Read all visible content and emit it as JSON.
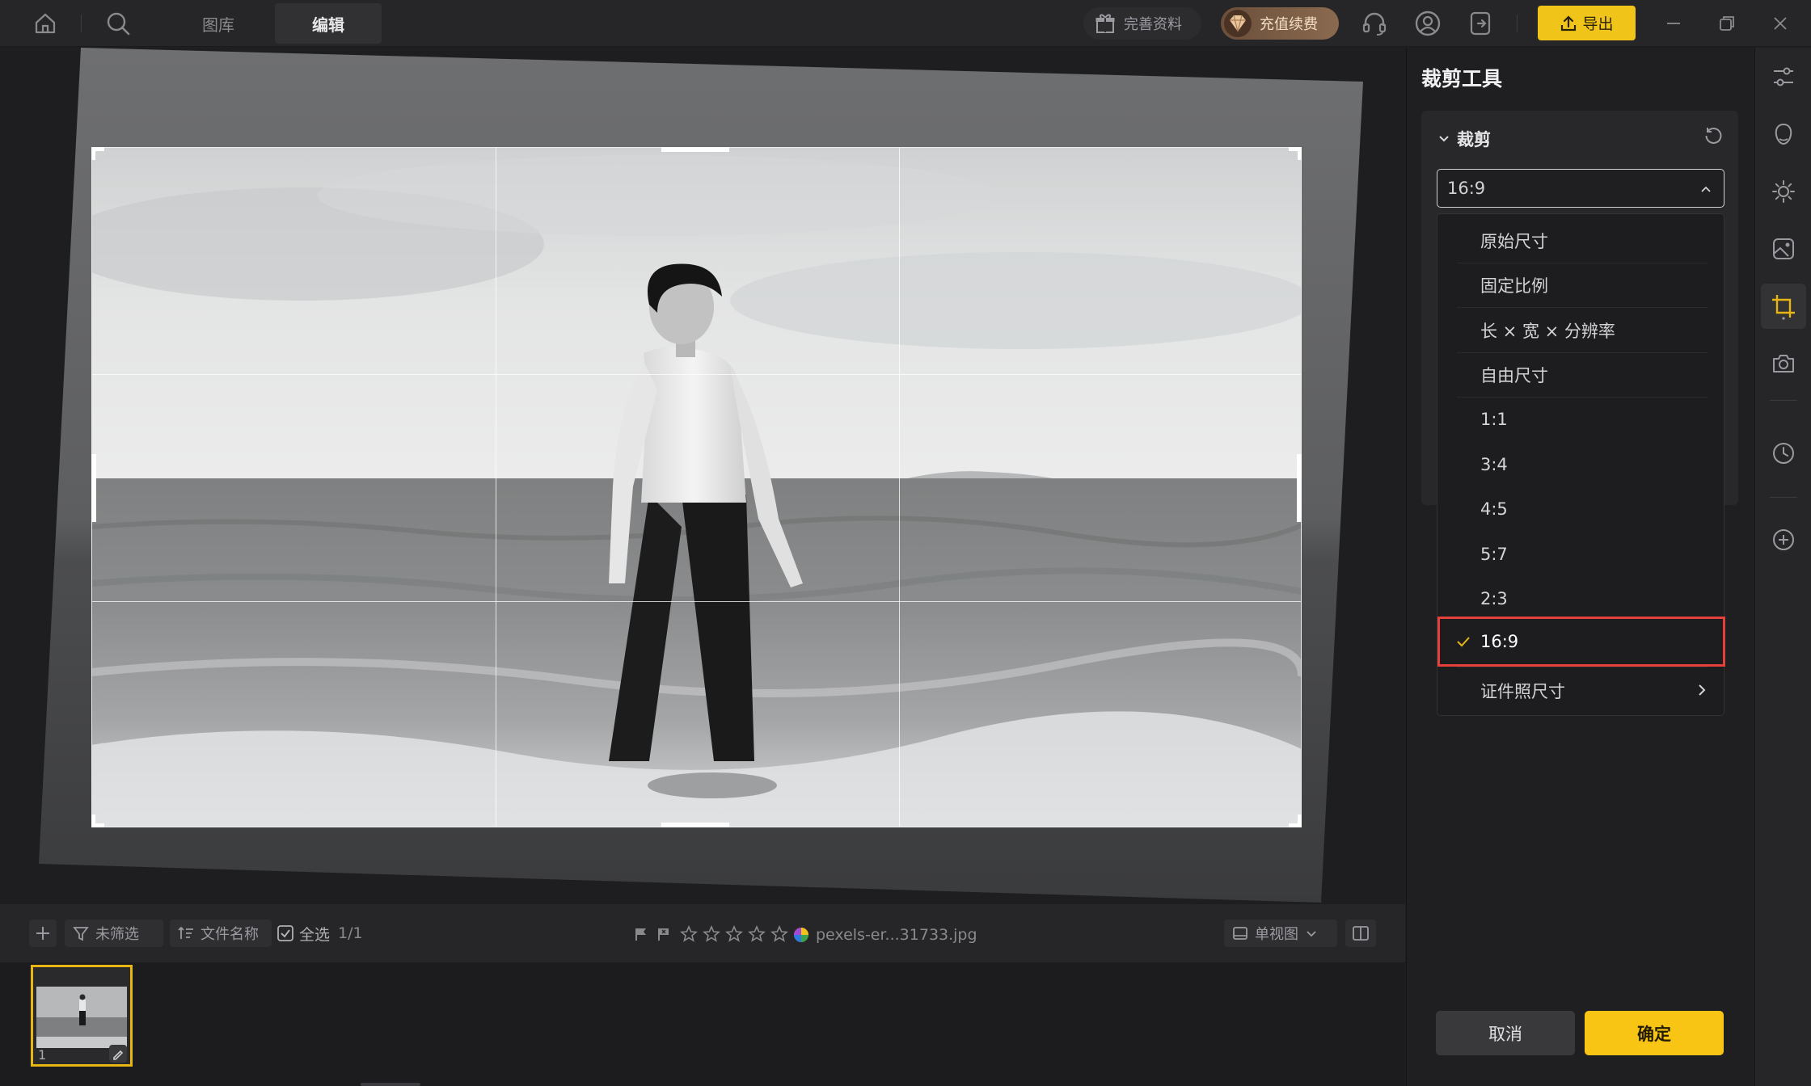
{
  "tabs": [
    {
      "label": "图库",
      "active": false
    },
    {
      "label": "编辑",
      "active": true
    }
  ],
  "header": {
    "complete_profile": "完善资料",
    "recharge": "充值续费",
    "export": "导出"
  },
  "bottom_toolbar": {
    "filter": "未筛选",
    "sort": "文件名称",
    "select_all": "全选",
    "selection_count": "1/1",
    "rating_stars": 5,
    "filename": "pexels-er...31733.jpg",
    "view_mode": "单视图"
  },
  "filmstrip": {
    "items": [
      {
        "index": "1"
      }
    ]
  },
  "panel": {
    "title": "裁剪工具",
    "section": "裁剪",
    "selected_ratio": "16:9",
    "options": [
      {
        "label": "原始尺寸"
      },
      {
        "label": "固定比例"
      },
      {
        "label": "长 × 宽 × 分辨率"
      },
      {
        "label": "自由尺寸"
      },
      {
        "label": "1:1"
      },
      {
        "label": "3:4"
      },
      {
        "label": "4:5"
      },
      {
        "label": "5:7"
      },
      {
        "label": "2:3"
      },
      {
        "label": "16:9"
      },
      {
        "label": "证件照尺寸"
      }
    ],
    "cancel": "取消",
    "confirm": "确定"
  },
  "colors": {
    "accent": "#f8c515",
    "selection_outline": "#e5403a",
    "thumb_border": "#e7b614"
  }
}
